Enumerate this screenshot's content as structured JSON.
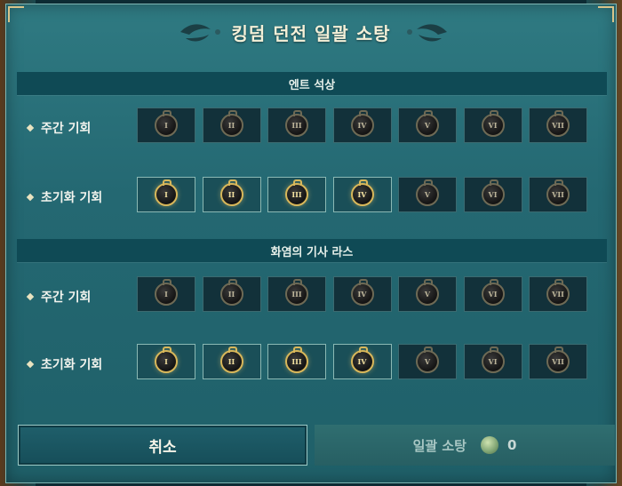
{
  "title": "킹덤 던전 일괄 소탕",
  "sections": [
    {
      "name": "엔트 석상",
      "rows": [
        {
          "label": "주간 기회",
          "slots": [
            {
              "numeral": "I",
              "active": false
            },
            {
              "numeral": "II",
              "active": false
            },
            {
              "numeral": "III",
              "active": false
            },
            {
              "numeral": "IV",
              "active": false
            },
            {
              "numeral": "V",
              "active": false
            },
            {
              "numeral": "VI",
              "active": false
            },
            {
              "numeral": "VII",
              "active": false
            }
          ]
        },
        {
          "label": "초기화 기회",
          "slots": [
            {
              "numeral": "I",
              "active": true
            },
            {
              "numeral": "II",
              "active": true
            },
            {
              "numeral": "III",
              "active": true
            },
            {
              "numeral": "IV",
              "active": true
            },
            {
              "numeral": "V",
              "active": false
            },
            {
              "numeral": "VI",
              "active": false
            },
            {
              "numeral": "VII",
              "active": false
            }
          ]
        }
      ]
    },
    {
      "name": "화염의 기사 라스",
      "rows": [
        {
          "label": "주간 기회",
          "slots": [
            {
              "numeral": "I",
              "active": false
            },
            {
              "numeral": "II",
              "active": false
            },
            {
              "numeral": "III",
              "active": false
            },
            {
              "numeral": "IV",
              "active": false
            },
            {
              "numeral": "V",
              "active": false
            },
            {
              "numeral": "VI",
              "active": false
            },
            {
              "numeral": "VII",
              "active": false
            }
          ]
        },
        {
          "label": "초기화 기회",
          "slots": [
            {
              "numeral": "I",
              "active": true
            },
            {
              "numeral": "II",
              "active": true
            },
            {
              "numeral": "III",
              "active": true
            },
            {
              "numeral": "IV",
              "active": true
            },
            {
              "numeral": "V",
              "active": false
            },
            {
              "numeral": "VI",
              "active": false
            },
            {
              "numeral": "VII",
              "active": false
            }
          ]
        }
      ]
    }
  ],
  "buttons": {
    "cancel_label": "취소",
    "sweep_label": "일괄 소탕",
    "sweep_cost": "0",
    "sweep_cost_icon": "leaf-coin-icon"
  },
  "colors": {
    "accent_gold": "#d8b75a",
    "panel_teal": "#246872"
  }
}
